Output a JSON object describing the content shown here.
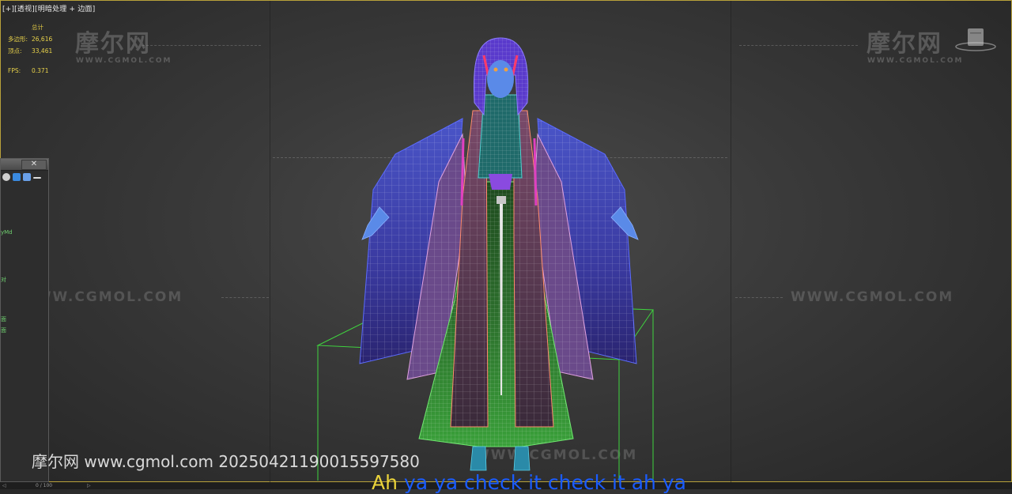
{
  "viewport": {
    "label": "[+][透视][明暗处理 + 边面]"
  },
  "stats": {
    "header": "总计",
    "polys_label": "多边形:",
    "polys_value": "26,616",
    "verts_label": "顶点:",
    "verts_value": "33,461",
    "fps_label": "FPS:",
    "fps_value": "0.371"
  },
  "watermarks": {
    "logo_text": "摩尔网",
    "logo_sub": "WWW.CGMOL.COM",
    "url_text": "WWW.CGMOL.COM"
  },
  "panel": {
    "close_label": "✕",
    "item1": "yMd",
    "item2": "对",
    "item3": "面",
    "item4": "面"
  },
  "timeline": {
    "frame": "0 / 100"
  },
  "footer": {
    "watermark": "摩尔网 www.cgmol.com 20250421190015597580"
  },
  "subtitle": {
    "first": "Ah ",
    "rest": "ya ya check it check it ah ya"
  },
  "colors": {
    "accent_frame": "#b8a13a",
    "stats_text": "#e8d24a",
    "bbox_green": "#3fd43f"
  }
}
